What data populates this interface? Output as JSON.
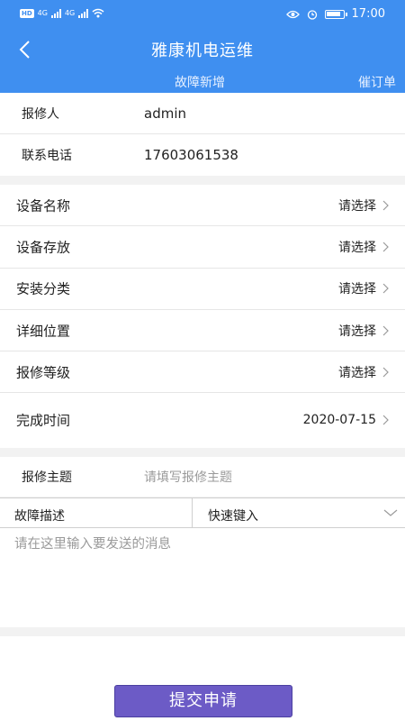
{
  "status": {
    "network": "4G",
    "time": "17:00",
    "hd": "HD"
  },
  "header": {
    "title": "雅康机电运维",
    "tab_add": "故障新增",
    "tab_urge": "催订单",
    "back_icon": "chevron-left-icon",
    "color": "#3f8ff0"
  },
  "reporter": {
    "label": "报修人",
    "value": "admin"
  },
  "phone": {
    "label": "联系电话",
    "value": "17603061538"
  },
  "fields": [
    {
      "label": "设备名称",
      "value": "请选择"
    },
    {
      "label": "设备存放",
      "value": "请选择"
    },
    {
      "label": "安装分类",
      "value": "请选择"
    },
    {
      "label": "详细位置",
      "value": "请选择"
    },
    {
      "label": "报修等级",
      "value": "请选择"
    },
    {
      "label": "完成时间",
      "value": "2020-07-15"
    }
  ],
  "subject": {
    "label": "报修主题",
    "placeholder": "请填写报修主题"
  },
  "description": {
    "label": "故障描述",
    "quick_label": "快速键入",
    "placeholder": "请在这里输入要发送的消息"
  },
  "submit": {
    "label": "提交申请",
    "color": "#6c5bc6"
  }
}
